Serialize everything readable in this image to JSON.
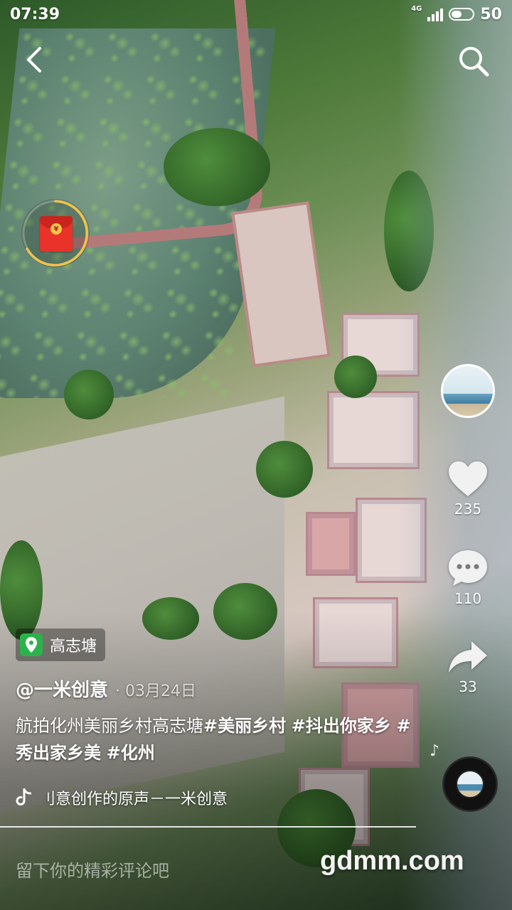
{
  "status_bar": {
    "time": "07:39",
    "network": "4G",
    "battery": "50",
    "battery_level": 0.5
  },
  "post": {
    "location": "高志塘",
    "author": "@一米创意",
    "date": "· 03月24日",
    "caption_text": "航拍化州美丽乡村高志塘",
    "hashtags": [
      "#美丽乡村",
      "#抖出你家乡",
      "#秀出家乡美",
      "#化州"
    ],
    "sound": "刂意创作的原声－一米创意"
  },
  "actions": {
    "likes": "235",
    "comments": "110",
    "shares": "33"
  },
  "comment_box": {
    "placeholder": "留下你的精彩评论吧"
  },
  "watermark": "gdmm.com",
  "icons": {
    "back": "chevron-left-icon",
    "search": "search-icon",
    "red_packet": "red-envelope-icon",
    "like": "heart-icon",
    "comment": "chat-bubble-icon",
    "share": "share-arrow-icon",
    "location": "map-pin-icon",
    "sound": "music-note-icon"
  },
  "colors": {
    "red_packet": "#e8322a",
    "ring": "#f0c24a",
    "location_badge": "#2bb34a"
  }
}
